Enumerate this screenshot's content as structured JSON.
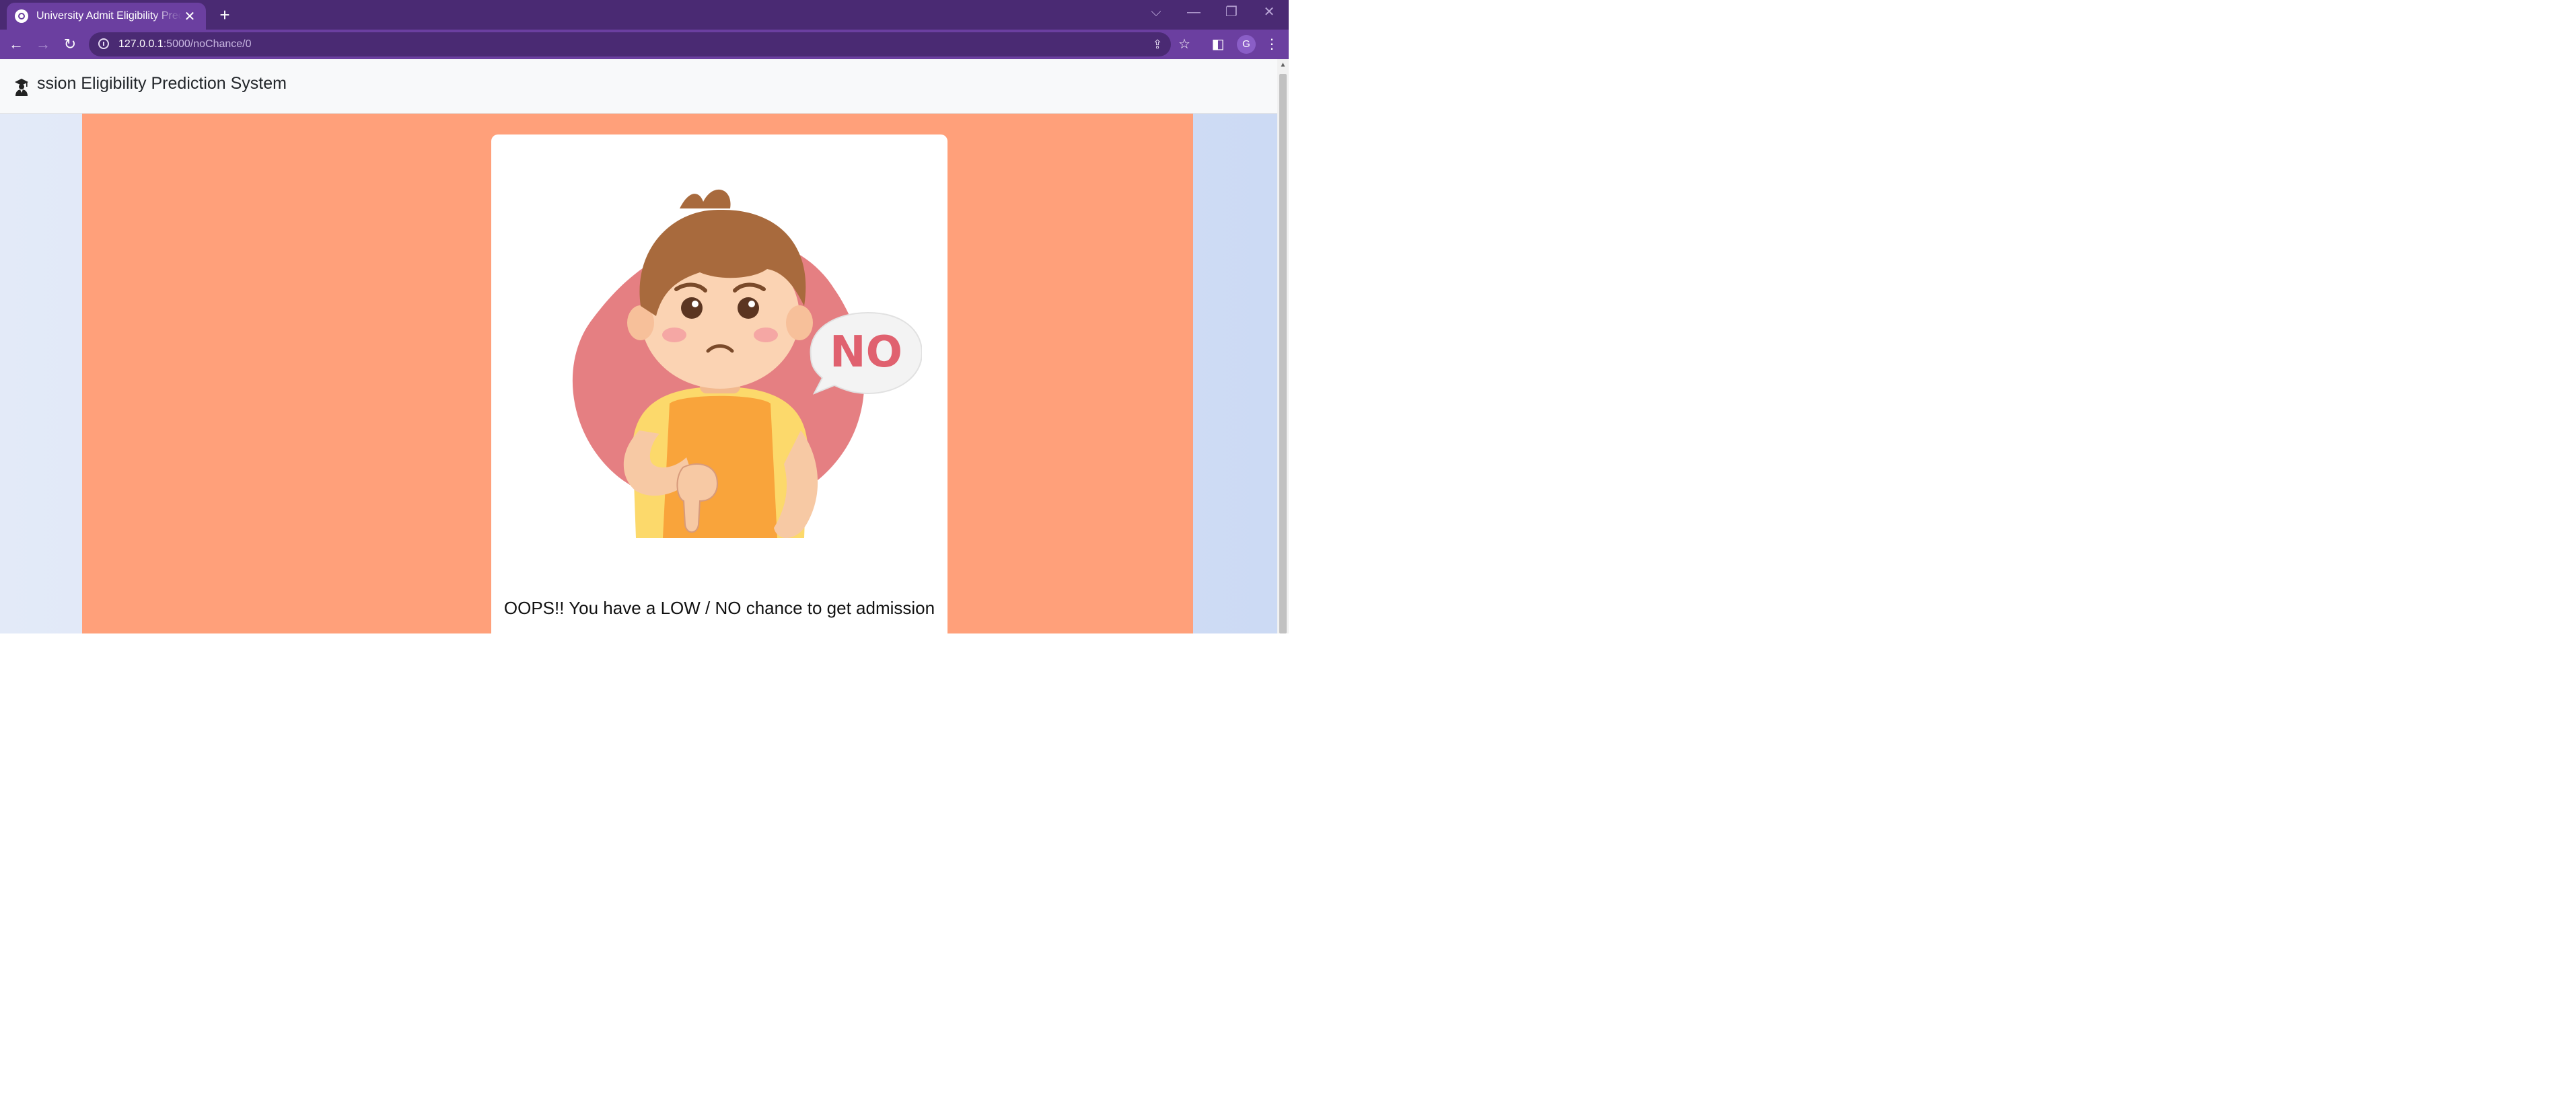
{
  "browser": {
    "tab": {
      "title": "University Admit Eligibility Prediction System",
      "close_glyph": "✕"
    },
    "new_tab_glyph": "+",
    "window_controls": {
      "tab_search": "⌵",
      "minimize": "—",
      "restore": "❐",
      "close": "✕"
    },
    "toolbar": {
      "back": "←",
      "forward": "→",
      "reload": "↻"
    },
    "address_bar": {
      "host": "127.0.0.1",
      "path": ":5000/noChance/0"
    },
    "icons": {
      "share": "⇪",
      "bookmark": "☆",
      "side_panel": "◧",
      "menu": "⋮"
    },
    "profile": {
      "initial": "G"
    }
  },
  "page": {
    "navbar": {
      "brand": "ssion Eligibility Prediction System"
    },
    "result": {
      "message": "OOPS!! You have a LOW / NO chance to get admission"
    },
    "illustration": {
      "bubble_text": "NO"
    },
    "watermark": "",
    "colors": {
      "hero": "#ffa07a",
      "tab_strip": "#4a2a73",
      "toolbar": "#6b3fa0"
    }
  }
}
